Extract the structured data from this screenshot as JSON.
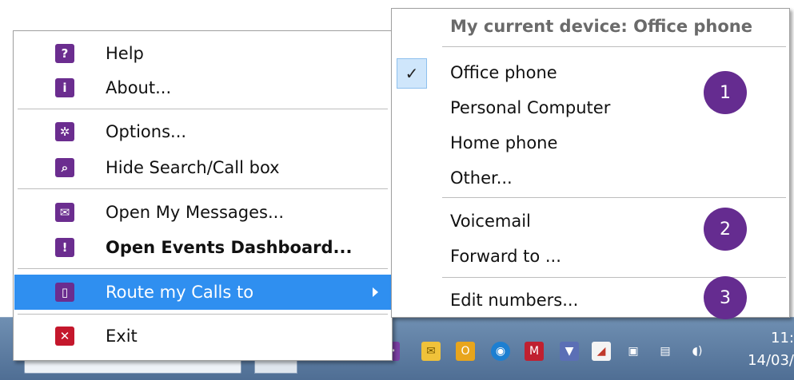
{
  "left_menu": {
    "items": [
      {
        "label": "Help",
        "icon": "help-icon",
        "glyph": "?"
      },
      {
        "label": "About...",
        "icon": "info-icon",
        "glyph": "i"
      },
      {
        "label": "Options...",
        "icon": "gear-icon",
        "glyph": "✲"
      },
      {
        "label": "Hide Search/Call box",
        "icon": "search-icon",
        "glyph": "⌕"
      },
      {
        "label": "Open My Messages...",
        "icon": "envelope-icon",
        "glyph": "✉"
      },
      {
        "label": "Open Events Dashboard...",
        "icon": "dashboard-icon",
        "glyph": "!"
      },
      {
        "label": "Route my Calls to",
        "icon": "phone-icon",
        "glyph": "▯"
      },
      {
        "label": "Exit",
        "icon": "exit-icon",
        "glyph": "✕"
      }
    ]
  },
  "right_menu": {
    "header": "My current device: Office phone",
    "check_glyph": "✓",
    "devices": [
      "Office phone",
      "Personal Computer",
      "Home phone",
      "Other..."
    ],
    "routing": [
      "Voicemail",
      "Forward to ..."
    ],
    "edit": "Edit numbers..."
  },
  "badges": [
    "1",
    "2",
    "3"
  ],
  "taskbar": {
    "clock_time": "11:",
    "clock_date": "14/03/"
  },
  "colors": {
    "accent": "#652c90",
    "highlight": "#2f8ff0",
    "exit": "#c4172c"
  }
}
